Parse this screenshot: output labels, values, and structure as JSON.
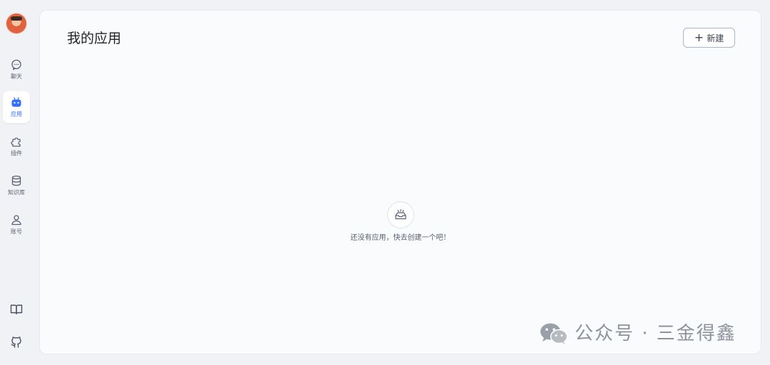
{
  "sidebar": {
    "avatar": "user-avatar",
    "items": [
      {
        "label": "聊天",
        "icon": "chat-bubble-icon",
        "active": false
      },
      {
        "label": "应用",
        "icon": "robot-icon",
        "active": true
      },
      {
        "label": "插件",
        "icon": "puzzle-icon",
        "active": false
      },
      {
        "label": "知识库",
        "icon": "database-icon",
        "active": false
      },
      {
        "label": "账号",
        "icon": "user-icon",
        "active": false
      }
    ],
    "bottom": [
      {
        "icon": "book-icon"
      },
      {
        "icon": "github-icon"
      }
    ]
  },
  "main": {
    "title": "我的应用",
    "new_button": {
      "label": "新建",
      "icon": "plus-icon"
    },
    "empty_state": {
      "icon": "empty-box-icon",
      "text": "还没有应用，快去创建一个吧！"
    }
  },
  "watermark": {
    "icon": "wechat-icon",
    "text": "公众号 · 三金得鑫"
  },
  "colors": {
    "accent": "#3370ff",
    "background": "#f1f2f5",
    "panel": "#fafbfc",
    "text_primary": "#1f2329",
    "text_secondary": "#5a6170",
    "watermark": "#8d929b"
  }
}
